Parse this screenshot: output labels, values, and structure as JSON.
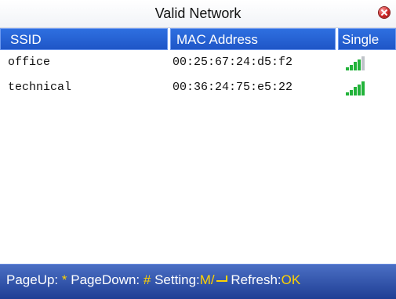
{
  "window": {
    "title": "Valid Network",
    "close_icon": "close-icon"
  },
  "table": {
    "columns": [
      "SSID",
      "MAC Address",
      "Single"
    ],
    "rows": [
      {
        "ssid": "office",
        "mac": "00:25:67:24:d5:f2",
        "signal_bars": 4,
        "signal_max": 5
      },
      {
        "ssid": "technical",
        "mac": "00:36:24:75:e5:22",
        "signal_bars": 5,
        "signal_max": 5
      }
    ]
  },
  "footer": {
    "pageup_label": "PageUp:",
    "pageup_key": "*",
    "pagedown_label": "PageDown:",
    "pagedown_key": "#",
    "setting_label": "Setting:",
    "setting_key": "M/",
    "refresh_label": "Refresh:",
    "refresh_key": "OK"
  },
  "colors": {
    "header_blue": "#1f56c7",
    "signal_green": "#22b33a",
    "footer_blue": "#1f3e94",
    "key_yellow": "#ffd200"
  }
}
